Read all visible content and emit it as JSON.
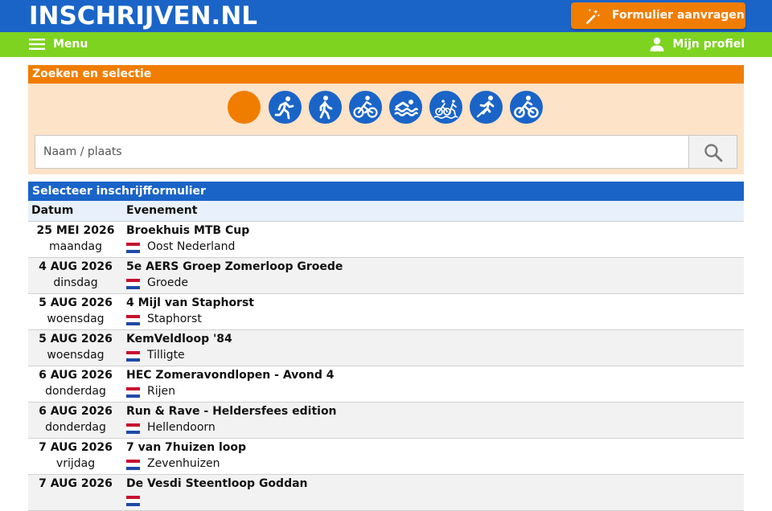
{
  "header": {
    "logo": "INSCHRIJVEN.NL",
    "form_button": "Formulier aanvragen"
  },
  "nav": {
    "menu": "Menu",
    "profile": "Mijn profiel"
  },
  "search": {
    "title": "Zoeken en selectie",
    "placeholder": "Naam / plaats",
    "sports": [
      "all",
      "running",
      "walking",
      "cycling",
      "swimming",
      "triathlon",
      "skating",
      "mountainbike"
    ]
  },
  "events": {
    "title": "Selecteer inschrijfformulier",
    "col_date": "Datum",
    "col_event": "Evenement",
    "rows": [
      {
        "date": "25 MEI 2026",
        "day": "maandag",
        "name": "Broekhuis MTB Cup",
        "place": "Oost Nederland"
      },
      {
        "date": "4 AUG 2026",
        "day": "dinsdag",
        "name": "5e AERS Groep Zomerloop Groede",
        "place": "Groede"
      },
      {
        "date": "5 AUG 2026",
        "day": "woensdag",
        "name": "4 Mijl van Staphorst",
        "place": "Staphorst"
      },
      {
        "date": "5 AUG 2026",
        "day": "woensdag",
        "name": "KemVeldloop '84",
        "place": "Tilligte"
      },
      {
        "date": "6 AUG 2026",
        "day": "donderdag",
        "name": "HEC Zomeravondlopen - Avond 4",
        "place": "Rijen"
      },
      {
        "date": "6 AUG 2026",
        "day": "donderdag",
        "name": "Run & Rave - Heldersfees edition",
        "place": "Hellendoorn"
      },
      {
        "date": "7 AUG 2026",
        "day": "vrijdag",
        "name": "7 van 7huizen loop",
        "place": "Zevenhuizen"
      },
      {
        "date": "7 AUG 2026",
        "day": "",
        "name": "De Vesdi Steentloop Goddan",
        "place": ""
      }
    ]
  },
  "colors": {
    "blue": "#1a64c8",
    "green": "#7ed321",
    "orange": "#f07d00",
    "panel": "#fde3c8"
  }
}
